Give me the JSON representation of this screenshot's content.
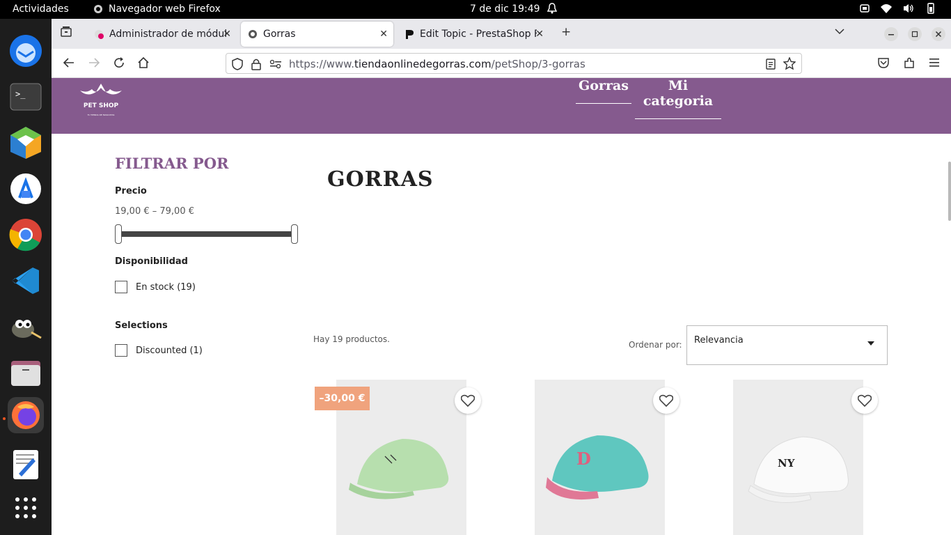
{
  "system": {
    "activities": "Actividades",
    "app_name": "Navegador web Firefox",
    "clock": "7 de dic  19:49"
  },
  "browser": {
    "tabs": [
      {
        "title": "Administrador de módulo",
        "favicon": "prestashop-admin-icon"
      },
      {
        "title": "Gorras",
        "favicon": "shop-icon"
      },
      {
        "title": "Edit Topic - PrestaShop F",
        "favicon": "prestashop-forum-icon"
      }
    ],
    "url_prefix": "https://www.",
    "url_domain": "tiendaonlinedegorras.com",
    "url_path": "/petShop/3-gorras"
  },
  "site": {
    "logo_title": "PET SHOP",
    "logo_subtitle": "TU TIENDA DE MASCOTAS",
    "menu": [
      "Gorras",
      "Mi categoria"
    ],
    "header_color": "#855a8e"
  },
  "filters": {
    "title": "FILTRAR POR",
    "price_title": "Precio",
    "price_range": "19,00 € – 79,00 €",
    "availability_title": "Disponibilidad",
    "availability_option": "En stock (19)",
    "selections_title": "Selections",
    "selections_option": "Discounted (1)"
  },
  "listing": {
    "category_title": "GORRAS",
    "product_count": "Hay 19 productos.",
    "sort_label": "Ordenar por:",
    "sort_value": "Relevancia",
    "products": [
      {
        "badge": "–30,00 €",
        "description": "light green cap"
      },
      {
        "description": "turquoise cap with pink logo"
      },
      {
        "description": "white cap with NY logo"
      }
    ]
  }
}
